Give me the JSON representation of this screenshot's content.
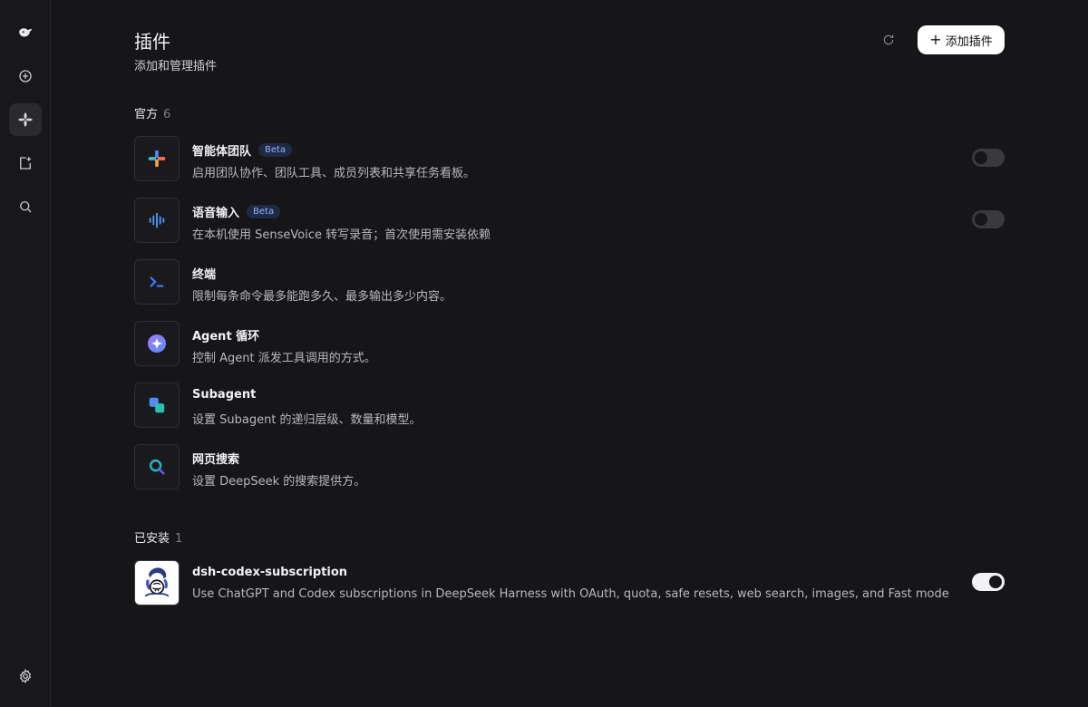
{
  "page": {
    "title": "插件",
    "subtitle": "添加和管理插件",
    "add_button_label": "添加插件"
  },
  "sections": {
    "official": {
      "label": "官方",
      "count": "6"
    },
    "installed": {
      "label": "已安装",
      "count": "1"
    }
  },
  "plugins": [
    {
      "name": "智能体团队",
      "badge": "Beta",
      "desc": "启用团队协作、团队工具、成员列表和共享任务看板。",
      "toggle": "off"
    },
    {
      "name": "语音输入",
      "badge": "Beta",
      "desc": "在本机使用 SenseVoice 转写录音；首次使用需安装依赖",
      "toggle": "off"
    },
    {
      "name": "终端",
      "desc": "限制每条命令最多能跑多久、最多输出多少内容。"
    },
    {
      "name": "Agent 循环",
      "desc": "控制 Agent 派发工具调用的方式。"
    },
    {
      "name": "Subagent",
      "desc": "设置 Subagent 的递归层级、数量和模型。"
    },
    {
      "name": "网页搜索",
      "desc": "设置 DeepSeek 的搜索提供方。"
    }
  ],
  "installed": [
    {
      "name": "dsh-codex-subscription",
      "desc": "Use ChatGPT and Codex subscriptions in DeepSeek Harness with OAuth, quota, safe resets, web search, images, and Fast mode",
      "toggle": "on"
    }
  ],
  "colors": {
    "background": "#161618",
    "accent_badge": "#8fb2ff",
    "toggle_on": "#f2f2f4",
    "toggle_off": "#3a3a3e"
  }
}
